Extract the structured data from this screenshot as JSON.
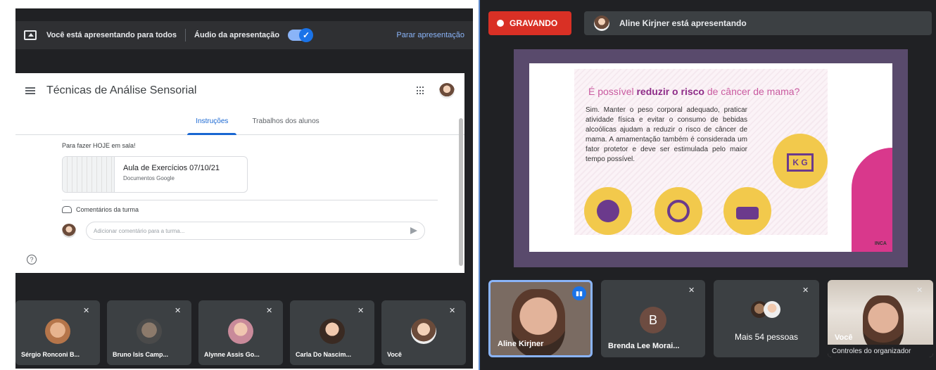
{
  "left": {
    "presenting_text": "Você está apresentando para todos",
    "audio_label": "Áudio da apresentação",
    "stop_label": "Parar apresentação",
    "classroom": {
      "title": "Técnicas de Análise Sensorial",
      "tabs": [
        "Instruções",
        "Trabalhos dos alunos"
      ],
      "note": "Para fazer HOJE em sala!",
      "doc_title": "Aula de Exercícios 07/10/21",
      "doc_sub": "Documentos Google",
      "comments_label": "Comentários da turma",
      "comment_placeholder": "Adicionar comentário para a turma..."
    },
    "participants": [
      {
        "name": "Sérgio Ronconi B..."
      },
      {
        "name": "Bruno Isis Camp..."
      },
      {
        "name": "Alynne Assis Go..."
      },
      {
        "name": "Carla Do Nascim..."
      },
      {
        "name": "Você"
      }
    ]
  },
  "right": {
    "recording_label": "GRAVANDO",
    "presenter_text": "Aline Kirjner está apresentando",
    "slide": {
      "title_prefix": "É possível ",
      "title_bold": "reduzir o risco",
      "title_suffix": " de câncer de mama?",
      "body": "Sim. Manter o peso corporal adequado, praticar atividade física e evitar o consumo de bebidas alcoólicas ajudam a reduzir o risco de câncer de mama. A amamentação também é considerada um fator protetor e deve ser estimulada pelo maior tempo possível.",
      "kg_label": "K G",
      "source": "INCA"
    },
    "tiles": [
      {
        "name": "Aline Kirjner"
      },
      {
        "name": "Brenda Lee Morai...",
        "initial": "B"
      },
      {
        "name": "Mais 54 pessoas"
      },
      {
        "name": "Você",
        "organizer": "Controles do organizador"
      }
    ]
  },
  "colors": {
    "recording": "#d93025",
    "accent": "#8ab4f8",
    "slide_purple": "#8e2c88",
    "slide_yellow": "#f2c94c"
  }
}
